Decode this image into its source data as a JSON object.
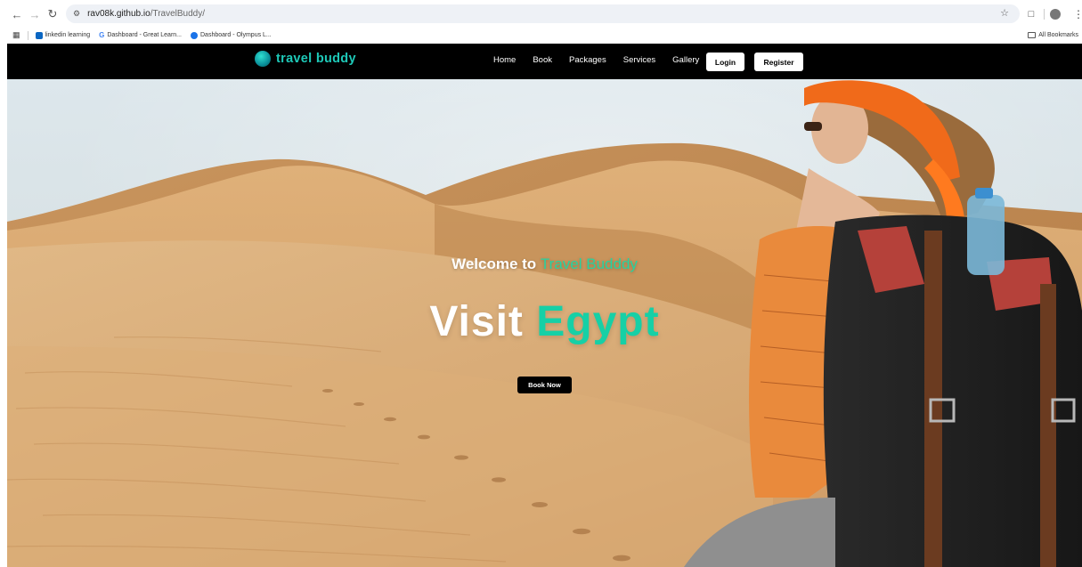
{
  "browser": {
    "url_host": "rav08k.github.io",
    "url_path": "/TravelBuddy/",
    "bookmarks": [
      {
        "label": "linkedin learning",
        "color": "#0a66c2"
      },
      {
        "label": "Dashboard - Great Learn...",
        "color": "#4285f4"
      },
      {
        "label": "Dashboard - Olympus L...",
        "color": "#1a73e8"
      }
    ],
    "all_bookmarks": "All Bookmarks"
  },
  "site": {
    "logo_text": "travel buddy",
    "menu": [
      "Home",
      "Book",
      "Packages",
      "Services",
      "Gallery"
    ],
    "login_label": "Login",
    "register_label": "Register"
  },
  "hero": {
    "welcome_prefix": "Welcome to",
    "welcome_accent": "Travel Budddy",
    "title_prefix": "Visit",
    "title_accent": "Egypt",
    "cta_label": "Book Now"
  },
  "colors": {
    "accent": "#16d0a6",
    "nav_bg": "#000000",
    "sand": "#dcae78"
  }
}
